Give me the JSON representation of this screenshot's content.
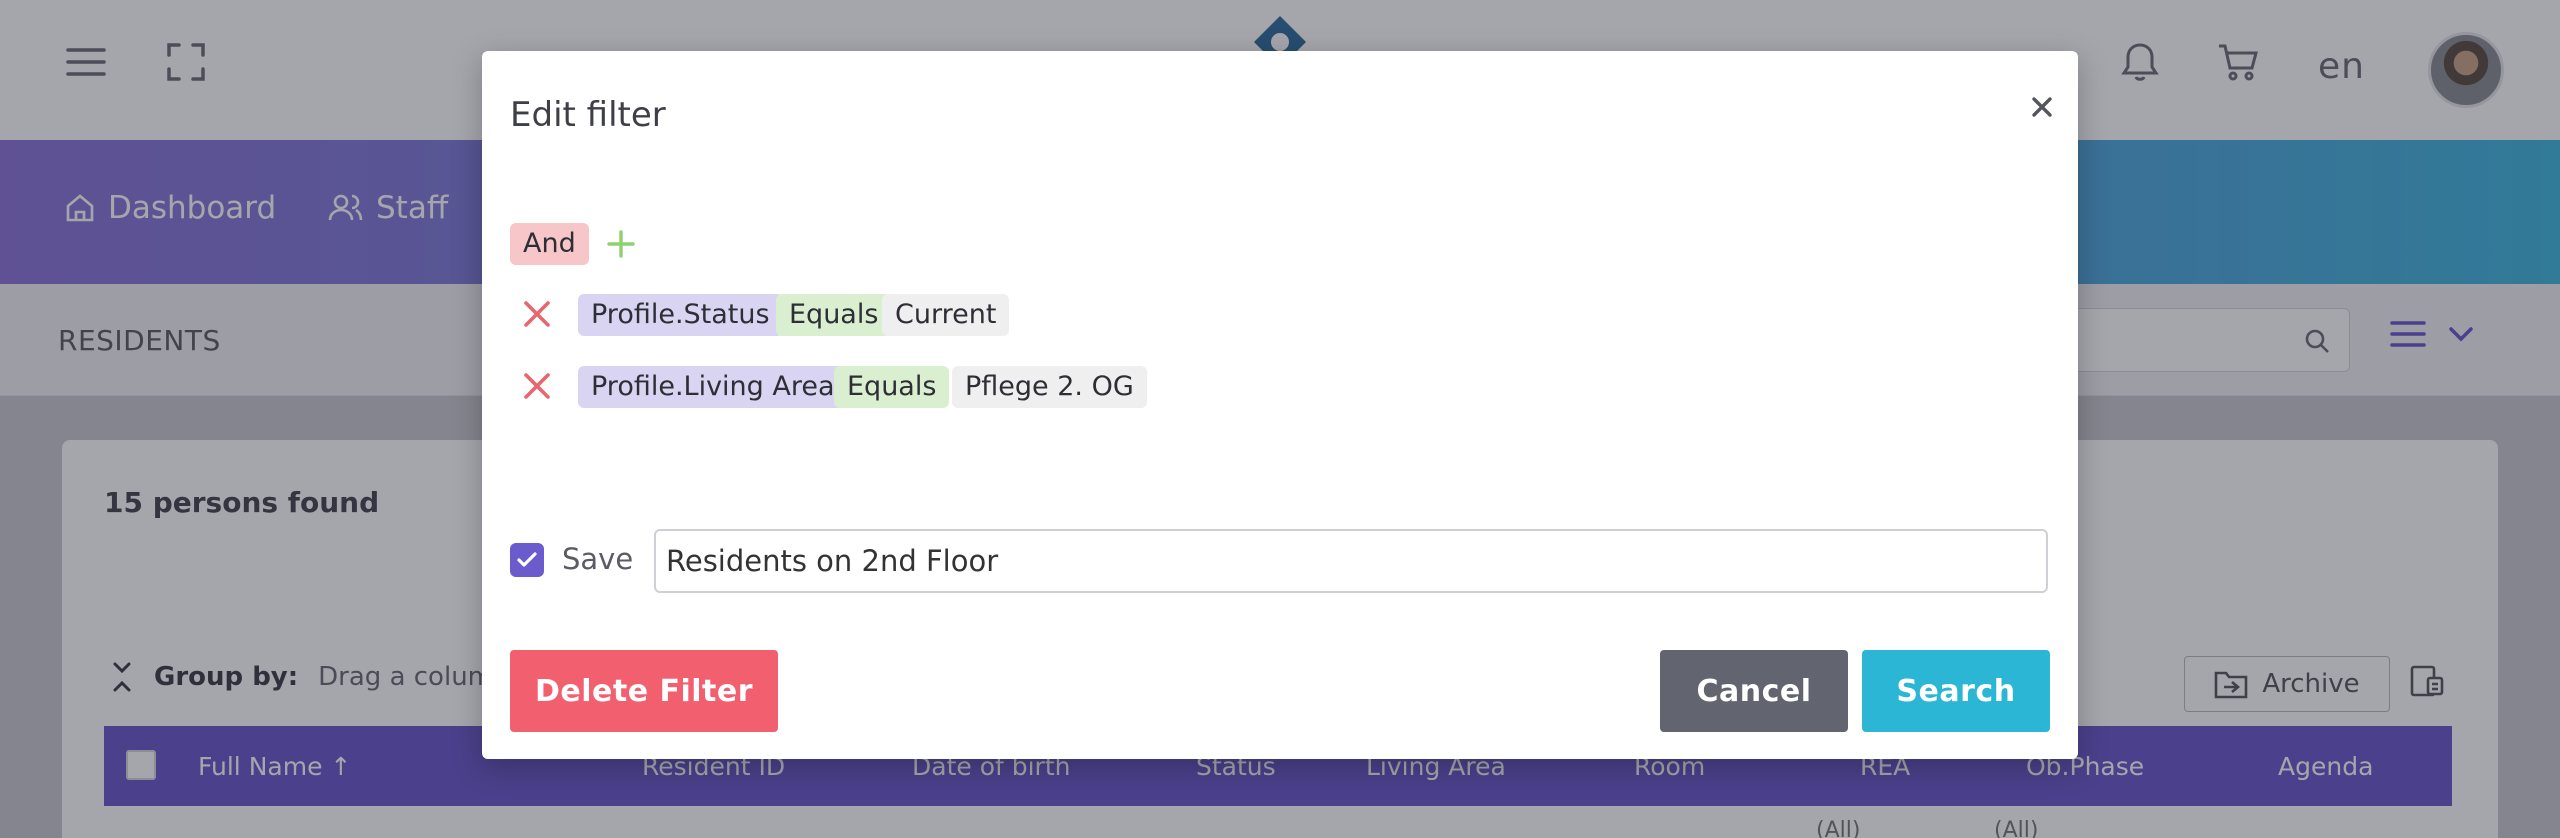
{
  "topbar": {
    "language": "en"
  },
  "nav": {
    "items": [
      {
        "label": "Dashboard"
      },
      {
        "label": "Staff"
      }
    ]
  },
  "subheader": {
    "title": "RESIDENTS"
  },
  "card": {
    "found_text": "15 persons found",
    "group_by_label": "Group by:",
    "group_by_hint": "Drag a column",
    "archive_label": "Archive",
    "columns": [
      "Full Name",
      "Resident ID",
      "Date of birth",
      "Status",
      "Living Area",
      "Room",
      "REA",
      "Ob.Phase",
      "Agenda"
    ],
    "sort_indicator": "↑",
    "filter_row": [
      "(All)",
      "(All)"
    ]
  },
  "modal": {
    "title": "Edit filter",
    "close_symbol": "×",
    "group_operator": "And",
    "conditions": [
      {
        "field": "Profile.Status",
        "operator": "Equals",
        "value": "Current"
      },
      {
        "field": "Profile.Living Area",
        "operator": "Equals",
        "value": "Pflege 2. OG"
      }
    ],
    "save": {
      "label": "Save",
      "checked": true,
      "value": "Residents on 2nd Floor"
    },
    "buttons": {
      "delete": "Delete Filter",
      "cancel": "Cancel",
      "search": "Search"
    }
  },
  "colors": {
    "accent_purple": "#6a55c8",
    "nav_gradient_start": "#8a72d8",
    "nav_gradient_end": "#3fb6de",
    "delete": "#f2606f",
    "cancel": "#62646f",
    "search": "#2cb6d6",
    "remove_icon": "#e8676f",
    "add_icon": "#8fd16f"
  },
  "icons": [
    "menu-icon",
    "fullscreen-icon",
    "bell-icon",
    "cart-icon",
    "home-icon",
    "users-icon",
    "search-icon",
    "list-icon",
    "chevron-down-icon",
    "collapse-icon",
    "archive-icon",
    "column-chooser-icon",
    "close-icon",
    "plus-icon",
    "remove-icon",
    "check-icon"
  ]
}
